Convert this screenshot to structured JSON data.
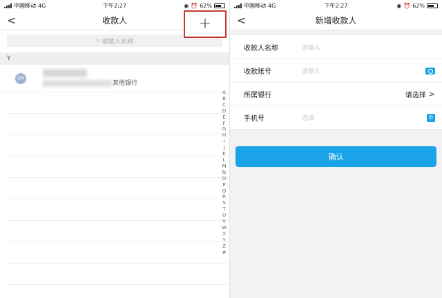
{
  "left": {
    "status": {
      "carrier": "中国移动",
      "network": "4G",
      "time": "下午2:27",
      "battery": "62%"
    },
    "nav": {
      "back": "<",
      "title": "收款人",
      "add": "+"
    },
    "search": {
      "placeholder": "收款人名称",
      "icon": "search-icon"
    },
    "section": "Y",
    "payee": {
      "avatar_text": "招商",
      "bank": "其他银行"
    },
    "index": [
      "A",
      "B",
      "C",
      "D",
      "E",
      "F",
      "G",
      "H",
      "I",
      "J",
      "K",
      "L",
      "M",
      "N",
      "O",
      "P",
      "Q",
      "R",
      "S",
      "T",
      "U",
      "V",
      "W",
      "X",
      "Y",
      "Z",
      "#"
    ]
  },
  "right": {
    "status": {
      "carrier": "中国移动",
      "network": "4G",
      "time": "下午2:27",
      "battery": "62%"
    },
    "nav": {
      "back": "<",
      "title": "新增收款人"
    },
    "form": {
      "name_label": "收款人名称",
      "name_placeholder": "请输入",
      "account_label": "收款账号",
      "account_placeholder": "请输入",
      "bank_label": "所属银行",
      "bank_value": "请选择",
      "bank_chevron": ">",
      "phone_label": "手机号",
      "phone_placeholder": "选填"
    },
    "confirm": "确认"
  },
  "colors": {
    "accent": "#1aa3e8",
    "highlight_box": "#c0392b"
  }
}
